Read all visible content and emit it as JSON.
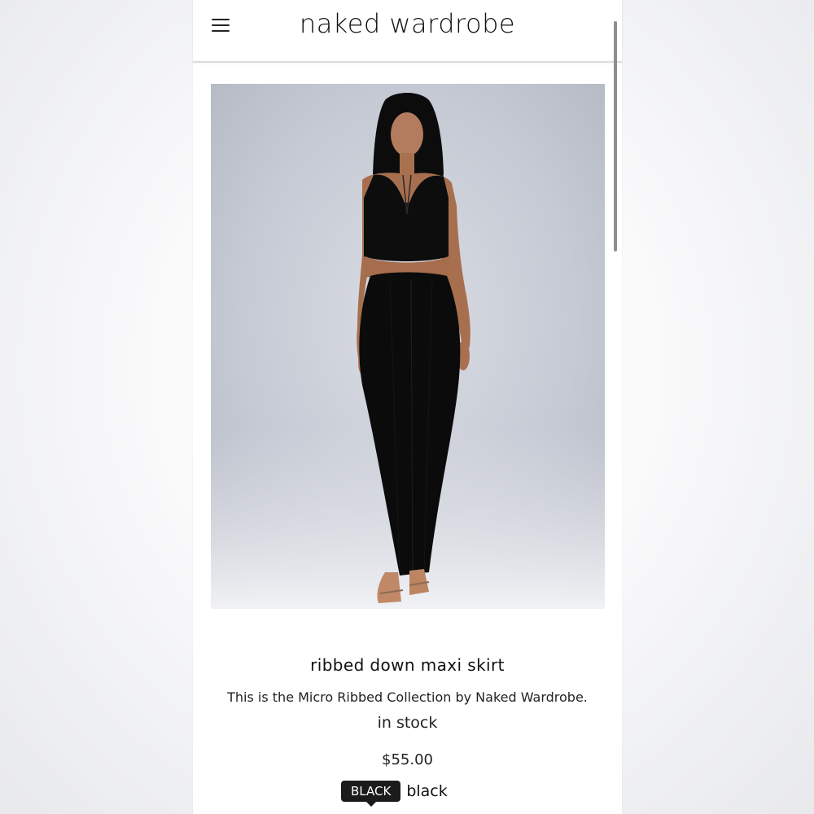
{
  "header": {
    "logo": "naked wardrobe",
    "menu_icon": "hamburger-menu-icon"
  },
  "product": {
    "image_alt": "model wearing black ribbed crop top and black ribbed maxi skirt",
    "title": "ribbed down maxi skirt",
    "description": "This is the Micro Ribbed Collection by Naked Wardrobe.",
    "stock": "in stock",
    "price": "$55.00",
    "color_option": {
      "tag": "BLACK",
      "label": "black",
      "swatch_color": "#1b1b1b"
    }
  },
  "colors": {
    "background": "#ffffff",
    "text": "#111111",
    "header_border": "#dcdcdc"
  }
}
